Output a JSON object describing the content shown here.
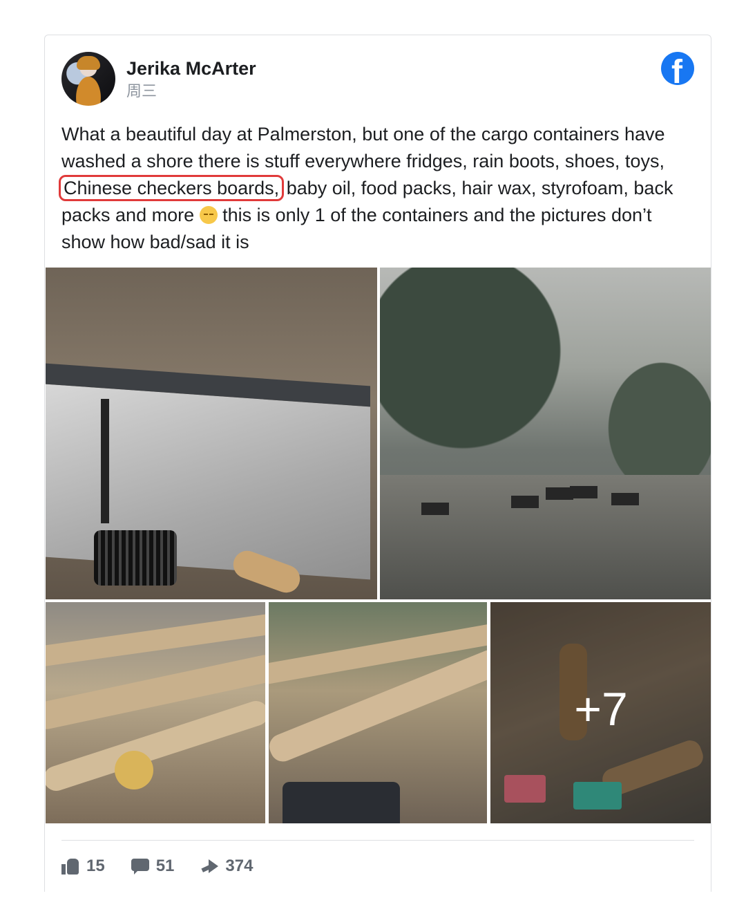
{
  "post": {
    "author": "Jerika McArter",
    "date": "周三",
    "platform_icon": "facebook-logo-icon",
    "text_before": "What a beautiful day at Palmerston, but one of the cargo containers have washed a shore there is stuff everywhere fridges, rain boots, shoes, toys,",
    "text_highlight": "Chinese checkers boards,",
    "text_middle": "baby oil, food packs, hair wax, styrofoam, back packs and more",
    "emoji": "disappointed-face-emoji",
    "text_after": "this is only 1 of the containers and the pictures don’t show how bad/sad it is",
    "highlight_color": "#e03a3a"
  },
  "photos": {
    "count_shown": 5,
    "more_label": "+7"
  },
  "stats": {
    "likes": "15",
    "comments": "51",
    "shares": "374"
  },
  "colors": {
    "brand_blue": "#1877f2",
    "secondary_text": "#8d949e",
    "action_text": "#606770"
  }
}
